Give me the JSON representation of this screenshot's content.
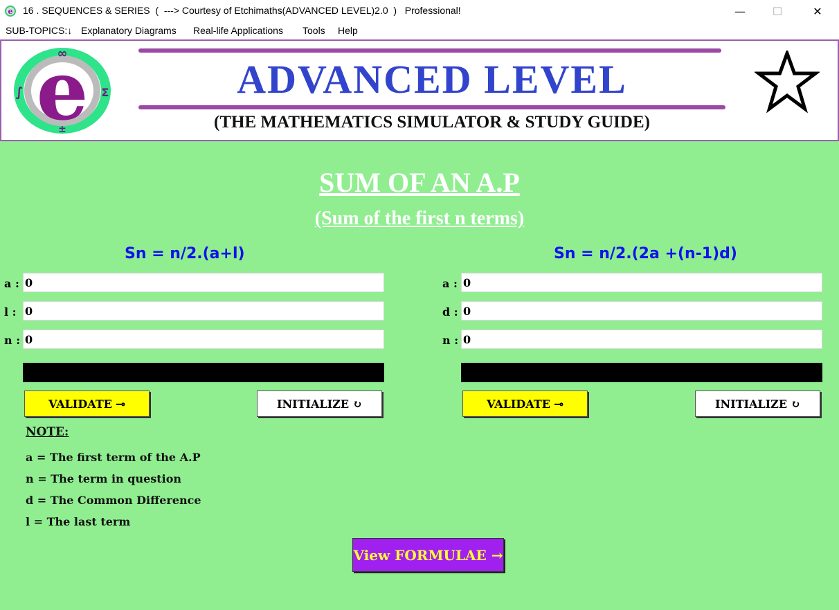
{
  "window": {
    "title": "16 . SEQUENCES & SERIES  (  ---> Courtesy of Etchimaths(ADVANCED LEVEL)2.0  )   Professional!",
    "minimize": "—",
    "maximize": "☐",
    "close": "✕"
  },
  "menu": {
    "items": [
      "SUB-TOPICS:↓",
      "Explanatory Diagrams",
      "Real-life Applications",
      "Tools",
      "Help"
    ]
  },
  "banner": {
    "title": "ADVANCED LEVEL",
    "subtitle": "(THE MATHEMATICS SIMULATOR & STUDY GUIDE)",
    "logo_letter": "e",
    "logo_symbols": [
      "∞",
      "∫",
      "Σ",
      "±"
    ]
  },
  "page": {
    "title": "SUM OF AN A.P",
    "subtitle": "(Sum of the first n terms)"
  },
  "left_panel": {
    "formula": "Sn = n/2.(a+l)",
    "fields": [
      {
        "label": "a :",
        "value": "0"
      },
      {
        "label": "l :",
        "value": "0"
      },
      {
        "label": "n :",
        "value": "0"
      }
    ],
    "validate_label": "VALIDATE ⊸",
    "initialize_label": "INITIALIZE ↻"
  },
  "right_panel": {
    "formula": "Sn = n/2.(2a +(n-1)d)",
    "fields": [
      {
        "label": "a :",
        "value": "0"
      },
      {
        "label": "d :",
        "value": "0"
      },
      {
        "label": "n :",
        "value": "0"
      }
    ],
    "validate_label": "VALIDATE ⊸",
    "initialize_label": "INITIALIZE ↻"
  },
  "note": {
    "title": "NOTE:",
    "lines": [
      "a = The first term of the A.P",
      "n = The term in question",
      "d = The Common Difference",
      "l = The last term"
    ]
  },
  "formulae_button": "View FORMULAE →",
  "colors": {
    "main_bg": "#90ee90",
    "banner_border": "#9a5fb0",
    "title_blue": "#3344cc",
    "formula_blue": "#1111ee",
    "validate_yellow": "#ffff00",
    "formulae_purple": "#a020f0"
  }
}
